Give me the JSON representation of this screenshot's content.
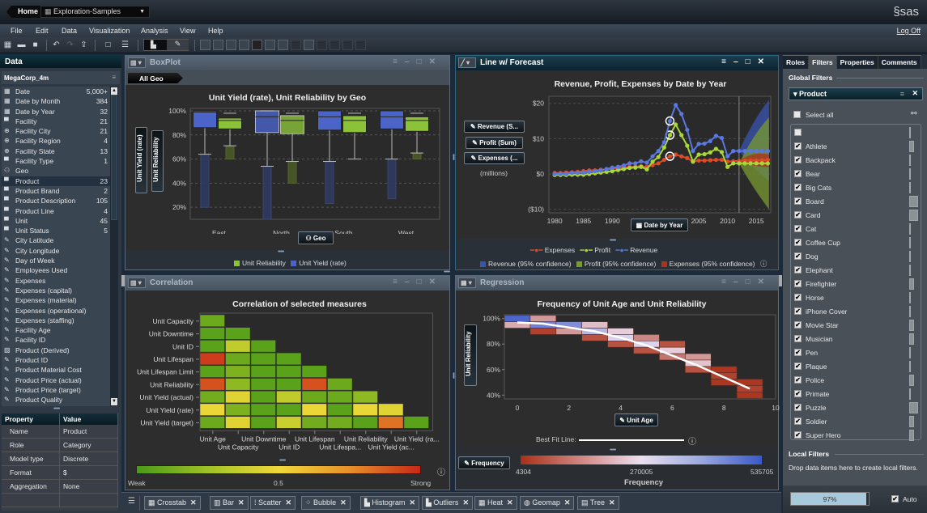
{
  "topbar": {
    "home_label": "Home",
    "report_name": "Exploration-Samples",
    "brand": "§sas"
  },
  "menu": {
    "items": [
      "File",
      "Edit",
      "Data",
      "Visualization",
      "Analysis",
      "View",
      "Help"
    ],
    "logoff": "Log Off"
  },
  "left": {
    "header": "Data",
    "dataset": "MegaCorp_4m",
    "items": [
      {
        "label": "Date",
        "count": "5,000+",
        "icon": "date"
      },
      {
        "label": "Date by Month",
        "count": "384",
        "icon": "date"
      },
      {
        "label": "Date by Year",
        "count": "32",
        "icon": "date"
      },
      {
        "label": "Facility",
        "count": "21",
        "icon": "category"
      },
      {
        "label": "Facility City",
        "count": "21",
        "icon": "geo"
      },
      {
        "label": "Facility Region",
        "count": "4",
        "icon": "geo"
      },
      {
        "label": "Facility State",
        "count": "13",
        "icon": "geo"
      },
      {
        "label": "Facility Type",
        "count": "1",
        "icon": "category"
      },
      {
        "label": "Geo",
        "count": "",
        "icon": "hierarchy"
      },
      {
        "label": "Product",
        "count": "23",
        "icon": "category",
        "selected": true
      },
      {
        "label": "Product Brand",
        "count": "2",
        "icon": "category"
      },
      {
        "label": "Product Description",
        "count": "105",
        "icon": "category"
      },
      {
        "label": "Product Line",
        "count": "4",
        "icon": "category"
      },
      {
        "label": "Unit",
        "count": "45",
        "icon": "category"
      },
      {
        "label": "Unit Status",
        "count": "5",
        "icon": "category"
      },
      {
        "label": "City Latitude",
        "count": "",
        "icon": "measure"
      },
      {
        "label": "City Longitude",
        "count": "",
        "icon": "measure"
      },
      {
        "label": "Day of Week",
        "count": "",
        "icon": "measure"
      },
      {
        "label": "Employees Used",
        "count": "",
        "icon": "measure"
      },
      {
        "label": "Expenses",
        "count": "",
        "icon": "measure"
      },
      {
        "label": "Expenses (capital)",
        "count": "",
        "icon": "measure"
      },
      {
        "label": "Expenses (material)",
        "count": "",
        "icon": "measure"
      },
      {
        "label": "Expenses (operational)",
        "count": "",
        "icon": "measure"
      },
      {
        "label": "Expenses (staffing)",
        "count": "",
        "icon": "measure"
      },
      {
        "label": "Facility Age",
        "count": "",
        "icon": "measure"
      },
      {
        "label": "Facility ID",
        "count": "",
        "icon": "measure"
      },
      {
        "label": "Product (Derived)",
        "count": "",
        "icon": "derived"
      },
      {
        "label": "Product ID",
        "count": "",
        "icon": "measure"
      },
      {
        "label": "Product Material Cost",
        "count": "",
        "icon": "measure"
      },
      {
        "label": "Product Price (actual)",
        "count": "",
        "icon": "measure"
      },
      {
        "label": "Product Price (target)",
        "count": "",
        "icon": "measure"
      },
      {
        "label": "Product Quality",
        "count": "",
        "icon": "measure"
      }
    ],
    "properties": {
      "headers": [
        "Property",
        "Value"
      ],
      "rows": [
        [
          "Name",
          "Product"
        ],
        [
          "Role",
          "Category"
        ],
        [
          "Model type",
          "Discrete"
        ],
        [
          "Format",
          "$"
        ],
        [
          "Aggregation",
          "None"
        ]
      ]
    }
  },
  "panels": {
    "boxplot": {
      "title": "BoxPlot",
      "breadcrumb": "All Geo",
      "role_y1": "Unit Yield (rate)",
      "role_y2": "Unit Reliability",
      "role_x": "Geo"
    },
    "line": {
      "title": "Line w/ Forecast",
      "roles": [
        "Revenue (S...",
        "Profit (Sum)",
        "Expenses (..."
      ],
      "units": "(millions)",
      "role_x": "Date by Year"
    },
    "correlation": {
      "title": "Correlation"
    },
    "regression": {
      "title": "Regression",
      "role_y": "Unit Reliability",
      "role_x": "Unit Age",
      "role_color": "Frequency",
      "best_fit_label": "Best Fit Line:"
    }
  },
  "chart_data": [
    {
      "type": "box",
      "title": "Unit Yield (rate), Unit Reliability by Geo",
      "categories": [
        "East",
        "North",
        "South",
        "West"
      ],
      "yticks": [
        "100%",
        "80%",
        "60%",
        "40%",
        "20%"
      ],
      "ylim": [
        10,
        102
      ],
      "series": [
        {
          "name": "Unit Yield (rate)",
          "color": "#4a64c8",
          "boxes": [
            {
              "min": 20,
              "q1": 86,
              "median": 99,
              "q3": 100,
              "max": 100,
              "lower_outlier_top": 64
            },
            {
              "min": 10,
              "q1": 82,
              "median": 95,
              "q3": 100,
              "max": 100,
              "lower_outlier_top": 54
            },
            {
              "min": 23,
              "q1": 84,
              "median": 95,
              "q3": 100,
              "max": 100,
              "lower_outlier_top": 58
            },
            {
              "min": 27,
              "q1": 85,
              "median": 95,
              "q3": 100,
              "max": 100,
              "lower_outlier_top": 60
            }
          ]
        },
        {
          "name": "Unit Reliability",
          "color": "#8cc23a",
          "boxes": [
            {
              "min": 60,
              "q1": 85,
              "median": 92,
              "q3": 94,
              "max": 98,
              "lower_outlier_top": 71
            },
            {
              "min": 40,
              "q1": 81,
              "median": 92,
              "q3": 96,
              "max": 98,
              "lower_outlier_top": 58
            },
            {
              "min": 60,
              "q1": 82,
              "median": 92,
              "q3": 96,
              "max": 98,
              "lower_outlier_top": null
            },
            {
              "min": 60,
              "q1": 83,
              "median": 92,
              "q3": 95,
              "max": 98,
              "lower_outlier_top": 65
            }
          ]
        }
      ],
      "legend": [
        "Unit Reliability",
        "Unit Yield (rate)"
      ]
    },
    {
      "type": "line",
      "title": "Revenue, Profit, Expenses by Date by Year",
      "xlim": [
        1979,
        2017.5
      ],
      "ylim": [
        -11,
        22
      ],
      "xticks": [
        "1980",
        "1985",
        "1990",
        "1995",
        "2000",
        "2005",
        "2010",
        "2015"
      ],
      "yticks": [
        "$20",
        "$10",
        "$0",
        "($10)"
      ],
      "ytick_values": [
        20,
        10,
        0,
        -10
      ],
      "forecast_start": 2012,
      "x": [
        1980,
        1981,
        1982,
        1983,
        1984,
        1985,
        1986,
        1987,
        1988,
        1989,
        1990,
        1991,
        1992,
        1993,
        1994,
        1995,
        1996,
        1997,
        1998,
        1999,
        2000,
        2001,
        2002,
        2003,
        2004,
        2005,
        2006,
        2007,
        2008,
        2009,
        2010,
        2011,
        2012,
        2013,
        2014,
        2015,
        2016,
        2017
      ],
      "series": [
        {
          "name": "Revenue",
          "color": "#5a78e0",
          "values": [
            0,
            0,
            0,
            0.3,
            0.3,
            0.4,
            0.6,
            0.8,
            1,
            1.4,
            1.8,
            2,
            2.4,
            3,
            3,
            3.6,
            3.2,
            5,
            6.5,
            9,
            15,
            19.5,
            17,
            12.5,
            6.5,
            8.5,
            8.6,
            9.3,
            10.8,
            10.2,
            5,
            6.5,
            6.5,
            6.5,
            6.5,
            6.5,
            6.5,
            6.5
          ]
        },
        {
          "name": "Profit",
          "color": "#a8d838",
          "values": [
            -0.3,
            -0.3,
            -0.3,
            -0.2,
            -0.2,
            -0.2,
            0,
            0.2,
            0.4,
            0.6,
            0.8,
            1.1,
            1.4,
            1.7,
            1.8,
            2,
            1.3,
            3.5,
            4.8,
            7.5,
            11,
            14,
            11,
            8,
            3.5,
            5.5,
            5.6,
            6.1,
            7.1,
            6.2,
            2,
            3,
            3,
            3,
            3,
            3,
            3,
            3
          ]
        },
        {
          "name": "Expenses",
          "color": "#e04a28",
          "values": [
            0.3,
            0.3,
            0.4,
            0.5,
            0.6,
            0.8,
            1,
            1,
            1.2,
            1.3,
            1.5,
            1.6,
            1.8,
            2,
            2.1,
            2.2,
            2,
            2.5,
            3,
            4,
            5,
            5.5,
            5,
            4.5,
            3.5,
            3.8,
            3.8,
            3.9,
            4,
            4,
            3.5,
            3.6,
            3.7,
            3.8,
            3.8,
            3.8,
            3.9,
            4
          ]
        }
      ],
      "highlighted_year": 2000,
      "confidence_bands": [
        {
          "name": "Revenue (95% confidence)",
          "color": "#3a55b0",
          "upper_end": 21,
          "lower_end": -2
        },
        {
          "name": "Profit (95% confidence)",
          "color": "#7a9a30",
          "upper_end": 16,
          "lower_end": -10
        },
        {
          "name": "Expenses (95% confidence)",
          "color": "#b03018",
          "upper_end": 5.5,
          "lower_end": 2
        }
      ],
      "legend": [
        "Expenses",
        "Profit",
        "Revenue"
      ]
    },
    {
      "type": "heatmap",
      "title": "Correlation of selected measures",
      "rows": [
        "Unit Capacity",
        "Unit Downtime",
        "Unit ID",
        "Unit Lifespan",
        "Unit Lifespan Limit",
        "Unit Reliability",
        "Unit Yield (actual)",
        "Unit Yield (rate)",
        "Unit Yield (target)"
      ],
      "columns": [
        "Unit Age",
        "Unit Capacity",
        "Unit Downtime",
        "Unit ID",
        "Unit Lifespan",
        "Unit Lifespa...",
        "Unit Reliability",
        "Unit Yield (ac...",
        "Unit Yield (ra..."
      ],
      "values": [
        [
          0.1
        ],
        [
          0.05,
          0.05
        ],
        [
          0.05,
          0.35,
          0.05
        ],
        [
          0.95,
          0.1,
          0.05,
          0.05
        ],
        [
          0.05,
          0.15,
          0.05,
          0.05,
          0.05
        ],
        [
          0.9,
          0.2,
          0.05,
          0.05,
          0.9,
          0.1
        ],
        [
          0.12,
          0.45,
          0.05,
          0.35,
          0.1,
          0.1,
          0.2
        ],
        [
          0.48,
          0.15,
          0.05,
          0.05,
          0.48,
          0.05,
          0.48,
          0.45
        ],
        [
          0.1,
          0.45,
          0.05,
          0.38,
          0.12,
          0.12,
          0.05,
          0.82,
          0.05
        ]
      ],
      "scale": {
        "min_label": "Weak",
        "mid_label": "0.5",
        "max_label": "Strong"
      }
    },
    {
      "type": "heatmap",
      "title": "Frequency of Unit Age and Unit Reliability",
      "xlabel": "Unit Age",
      "ylabel": "Unit Reliability",
      "xlim": [
        -0.5,
        10
      ],
      "ylim": [
        37,
        103
      ],
      "xticks": [
        "0",
        "2",
        "4",
        "6",
        "8",
        "10"
      ],
      "yticks": [
        "100%",
        "80%",
        "60%",
        "40%"
      ],
      "cells": [
        {
          "x": 0,
          "y": 100,
          "f": 0.95
        },
        {
          "x": 0,
          "y": 95,
          "f": 0.35
        },
        {
          "x": 1,
          "y": 100,
          "f": 0.3
        },
        {
          "x": 1,
          "y": 95,
          "f": 0.85
        },
        {
          "x": 1,
          "y": 90,
          "f": 0.05
        },
        {
          "x": 2,
          "y": 95,
          "f": 0.8
        },
        {
          "x": 2,
          "y": 90,
          "f": 0.3
        },
        {
          "x": 3,
          "y": 95,
          "f": 0.4
        },
        {
          "x": 3,
          "y": 90,
          "f": 0.65
        },
        {
          "x": 3,
          "y": 85,
          "f": 0.1
        },
        {
          "x": 4,
          "y": 90,
          "f": 0.45
        },
        {
          "x": 4,
          "y": 85,
          "f": 0.55
        },
        {
          "x": 4,
          "y": 80,
          "f": 0.1
        },
        {
          "x": 5,
          "y": 85,
          "f": 0.25
        },
        {
          "x": 5,
          "y": 80,
          "f": 0.55
        },
        {
          "x": 5,
          "y": 75,
          "f": 0.1
        },
        {
          "x": 6,
          "y": 80,
          "f": 0.1
        },
        {
          "x": 6,
          "y": 75,
          "f": 0.45
        },
        {
          "x": 6,
          "y": 70,
          "f": 0.2
        },
        {
          "x": 7,
          "y": 70,
          "f": 0.3
        },
        {
          "x": 7,
          "y": 65,
          "f": 0.42
        },
        {
          "x": 7,
          "y": 60,
          "f": 0.1
        },
        {
          "x": 8,
          "y": 60,
          "f": 0.02
        },
        {
          "x": 8,
          "y": 55,
          "f": 0.05
        },
        {
          "x": 8,
          "y": 50,
          "f": 0.02
        },
        {
          "x": 9,
          "y": 50,
          "f": 0.02
        },
        {
          "x": 9,
          "y": 45,
          "f": 0.05
        },
        {
          "x": 9,
          "y": 40,
          "f": 0.02
        }
      ],
      "best_fit": [
        [
          0,
          97
        ],
        [
          1,
          96
        ],
        [
          2,
          93
        ],
        [
          3,
          90
        ],
        [
          4,
          85
        ],
        [
          5,
          79
        ],
        [
          6,
          71
        ],
        [
          7,
          63
        ],
        [
          8,
          54
        ],
        [
          9,
          45
        ]
      ],
      "color_scale": {
        "min": "4304",
        "mid": "270005",
        "max": "535705",
        "title": "Frequency"
      }
    }
  ],
  "right": {
    "tabs": [
      "Roles",
      "Filters",
      "Properties",
      "Comments"
    ],
    "active_tab": "Filters",
    "global_filters_label": "Global Filters",
    "filter_name": "Product",
    "select_all": "Select all",
    "items": [
      {
        "label": "",
        "checked": false,
        "freq": 0.05
      },
      {
        "label": "Athlete",
        "checked": true,
        "freq": 0.45
      },
      {
        "label": "Backpack",
        "checked": true,
        "freq": 0.05
      },
      {
        "label": "Bear",
        "checked": true,
        "freq": 0.05
      },
      {
        "label": "Big Cats",
        "checked": true,
        "freq": 0.05
      },
      {
        "label": "Board",
        "checked": true,
        "freq": 0.75
      },
      {
        "label": "Card",
        "checked": true,
        "freq": 0.75
      },
      {
        "label": "Cat",
        "checked": true,
        "freq": 0.05
      },
      {
        "label": "Coffee Cup",
        "checked": true,
        "freq": 0.1
      },
      {
        "label": "Dog",
        "checked": true,
        "freq": 0.05
      },
      {
        "label": "Elephant",
        "checked": true,
        "freq": 0.05
      },
      {
        "label": "Firefighter",
        "checked": true,
        "freq": 0.45
      },
      {
        "label": "Horse",
        "checked": true,
        "freq": 0.05
      },
      {
        "label": "iPhone Cover",
        "checked": true,
        "freq": 0.1
      },
      {
        "label": "Movie Star",
        "checked": true,
        "freq": 0.45
      },
      {
        "label": "Musician",
        "checked": true,
        "freq": 0.45
      },
      {
        "label": "Pen",
        "checked": true,
        "freq": 0.05
      },
      {
        "label": "Plaque",
        "checked": true,
        "freq": 0.05
      },
      {
        "label": "Police",
        "checked": true,
        "freq": 0.4
      },
      {
        "label": "Primate",
        "checked": true,
        "freq": 0.05
      },
      {
        "label": "Puzzle",
        "checked": true,
        "freq": 0.8
      },
      {
        "label": "Soldier",
        "checked": true,
        "freq": 0.45
      },
      {
        "label": "Super Hero",
        "checked": true,
        "freq": 0.45
      }
    ],
    "local_filters_label": "Local Filters",
    "local_hint": "Drop data items here to create local filters.",
    "progress": 0.97,
    "progress_label": "97%",
    "auto_label": "Auto"
  },
  "bottom": {
    "tabs": [
      "Crosstab",
      "Bar",
      "Scatter",
      "Bubble",
      "Histogram",
      "Outliers",
      "Heat",
      "Geomap",
      "Tree"
    ]
  }
}
